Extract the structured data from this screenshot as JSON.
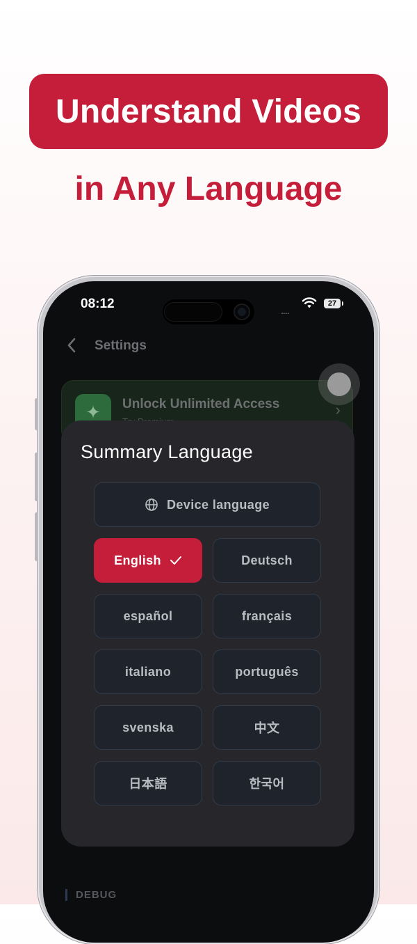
{
  "promo": {
    "headline": "Understand Videos",
    "subheadline": "in Any Language"
  },
  "status_bar": {
    "time": "08:12",
    "signal": "....",
    "battery": "27"
  },
  "nav": {
    "title": "Settings"
  },
  "premium_card": {
    "title": "Unlock Unlimited Access",
    "subtitle": "Try Premium",
    "icon": "sparkles-icon"
  },
  "sheet": {
    "title": "Summary Language",
    "device_language": "Device language",
    "languages": [
      {
        "label": "English",
        "selected": true
      },
      {
        "label": "Deutsch",
        "selected": false
      },
      {
        "label": "español",
        "selected": false
      },
      {
        "label": "français",
        "selected": false
      },
      {
        "label": "italiano",
        "selected": false
      },
      {
        "label": "português",
        "selected": false
      },
      {
        "label": "svenska",
        "selected": false
      },
      {
        "label": "中文",
        "selected": false
      },
      {
        "label": "日本語",
        "selected": false
      },
      {
        "label": "한국어",
        "selected": false
      }
    ]
  },
  "sections": {
    "debug": "DEBUG"
  },
  "colors": {
    "brand": "#c41e3a",
    "sheet_bg": "#26262b",
    "button_bg": "#1f242c"
  }
}
